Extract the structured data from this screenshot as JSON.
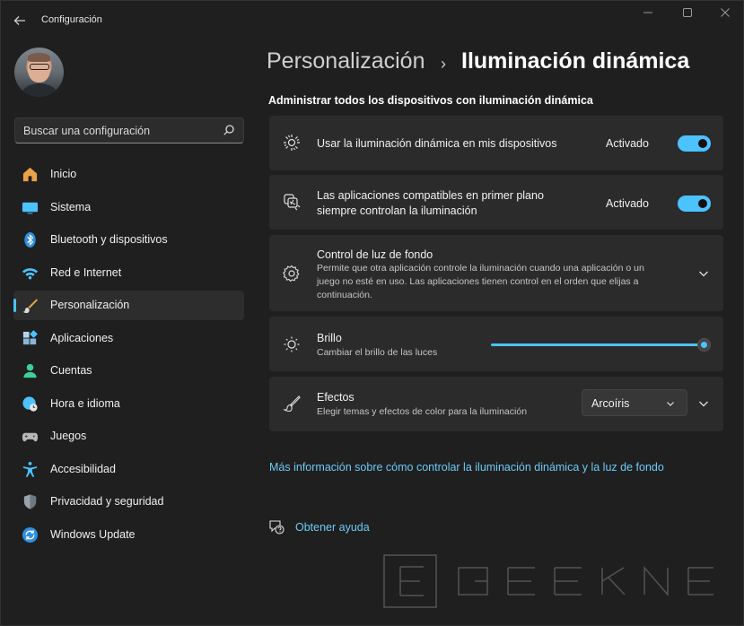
{
  "window": {
    "title": "Configuración",
    "back_icon": "arrow-left-icon",
    "controls": [
      "minimize-icon",
      "maximize-icon",
      "close-icon"
    ]
  },
  "sidebar": {
    "search_placeholder": "Buscar una configuración",
    "items": [
      {
        "label": "Inicio",
        "icon": "home-icon",
        "color": "#e9a24a"
      },
      {
        "label": "Sistema",
        "icon": "monitor-icon",
        "color": "#4cc2ff"
      },
      {
        "label": "Bluetooth y dispositivos",
        "icon": "bluetooth-icon",
        "color": "#2f8fe0"
      },
      {
        "label": "Red e Internet",
        "icon": "wifi-icon",
        "color": "#4cc2ff"
      },
      {
        "label": "Personalización",
        "icon": "brush-icon",
        "color": "#e9a24a",
        "active": true
      },
      {
        "label": "Aplicaciones",
        "icon": "apps-icon",
        "color": "#8ab4d8"
      },
      {
        "label": "Cuentas",
        "icon": "person-icon",
        "color": "#3fcf9a"
      },
      {
        "label": "Hora e idioma",
        "icon": "globe-clock-icon",
        "color": "#4cc2ff"
      },
      {
        "label": "Juegos",
        "icon": "gamepad-icon",
        "color": "#b8b8b8"
      },
      {
        "label": "Accesibilidad",
        "icon": "accessibility-icon",
        "color": "#4cc2ff"
      },
      {
        "label": "Privacidad y seguridad",
        "icon": "shield-icon",
        "color": "#9aa3ad"
      },
      {
        "label": "Windows Update",
        "icon": "update-icon",
        "color": "#2f8fe0"
      }
    ]
  },
  "main": {
    "breadcrumb_parent": "Personalización",
    "breadcrumb_separator": "›",
    "breadcrumb_current": "Iluminación dinámica",
    "section_title": "Administrar todos los dispositivos con iluminación dinámica",
    "cards": {
      "use_lighting": {
        "title": "Usar la iluminación dinámica en mis dispositivos",
        "toggle_label": "Activado",
        "toggle_on": true,
        "icon": "sun-rays-icon"
      },
      "foreground_apps": {
        "title_line1": "Las aplicaciones compatibles en primer plano",
        "title_line2": "siempre controlan la iluminación",
        "toggle_label": "Activado",
        "toggle_on": true,
        "icon": "app-layers-icon"
      },
      "background_control": {
        "title": "Control de luz de fondo",
        "subtitle_line1": "Permite que otra aplicación controle la iluminación cuando una aplicación o un",
        "subtitle_line2": "juego no esté en uso. Las aplicaciones tienen control en el orden que elijas a",
        "subtitle_line3": "continuación.",
        "icon": "gear-icon"
      },
      "brightness": {
        "title": "Brillo",
        "subtitle": "Cambiar el brillo de las luces",
        "level_percent": 100,
        "icon": "brightness-icon"
      },
      "effects": {
        "title": "Efectos",
        "subtitle": "Elegir temas y efectos de color para la iluminación",
        "selected": "Arcoíris",
        "icon": "brush-icon"
      }
    },
    "more_info_link": "Más información sobre cómo controlar la iluminación dinámica y la luz de fondo",
    "help_link": "Obtener ayuda"
  },
  "colors": {
    "accent": "#4cc2ff",
    "link": "#6ccaf5",
    "card": "#2b2b2b",
    "background": "#1f1f1f"
  }
}
